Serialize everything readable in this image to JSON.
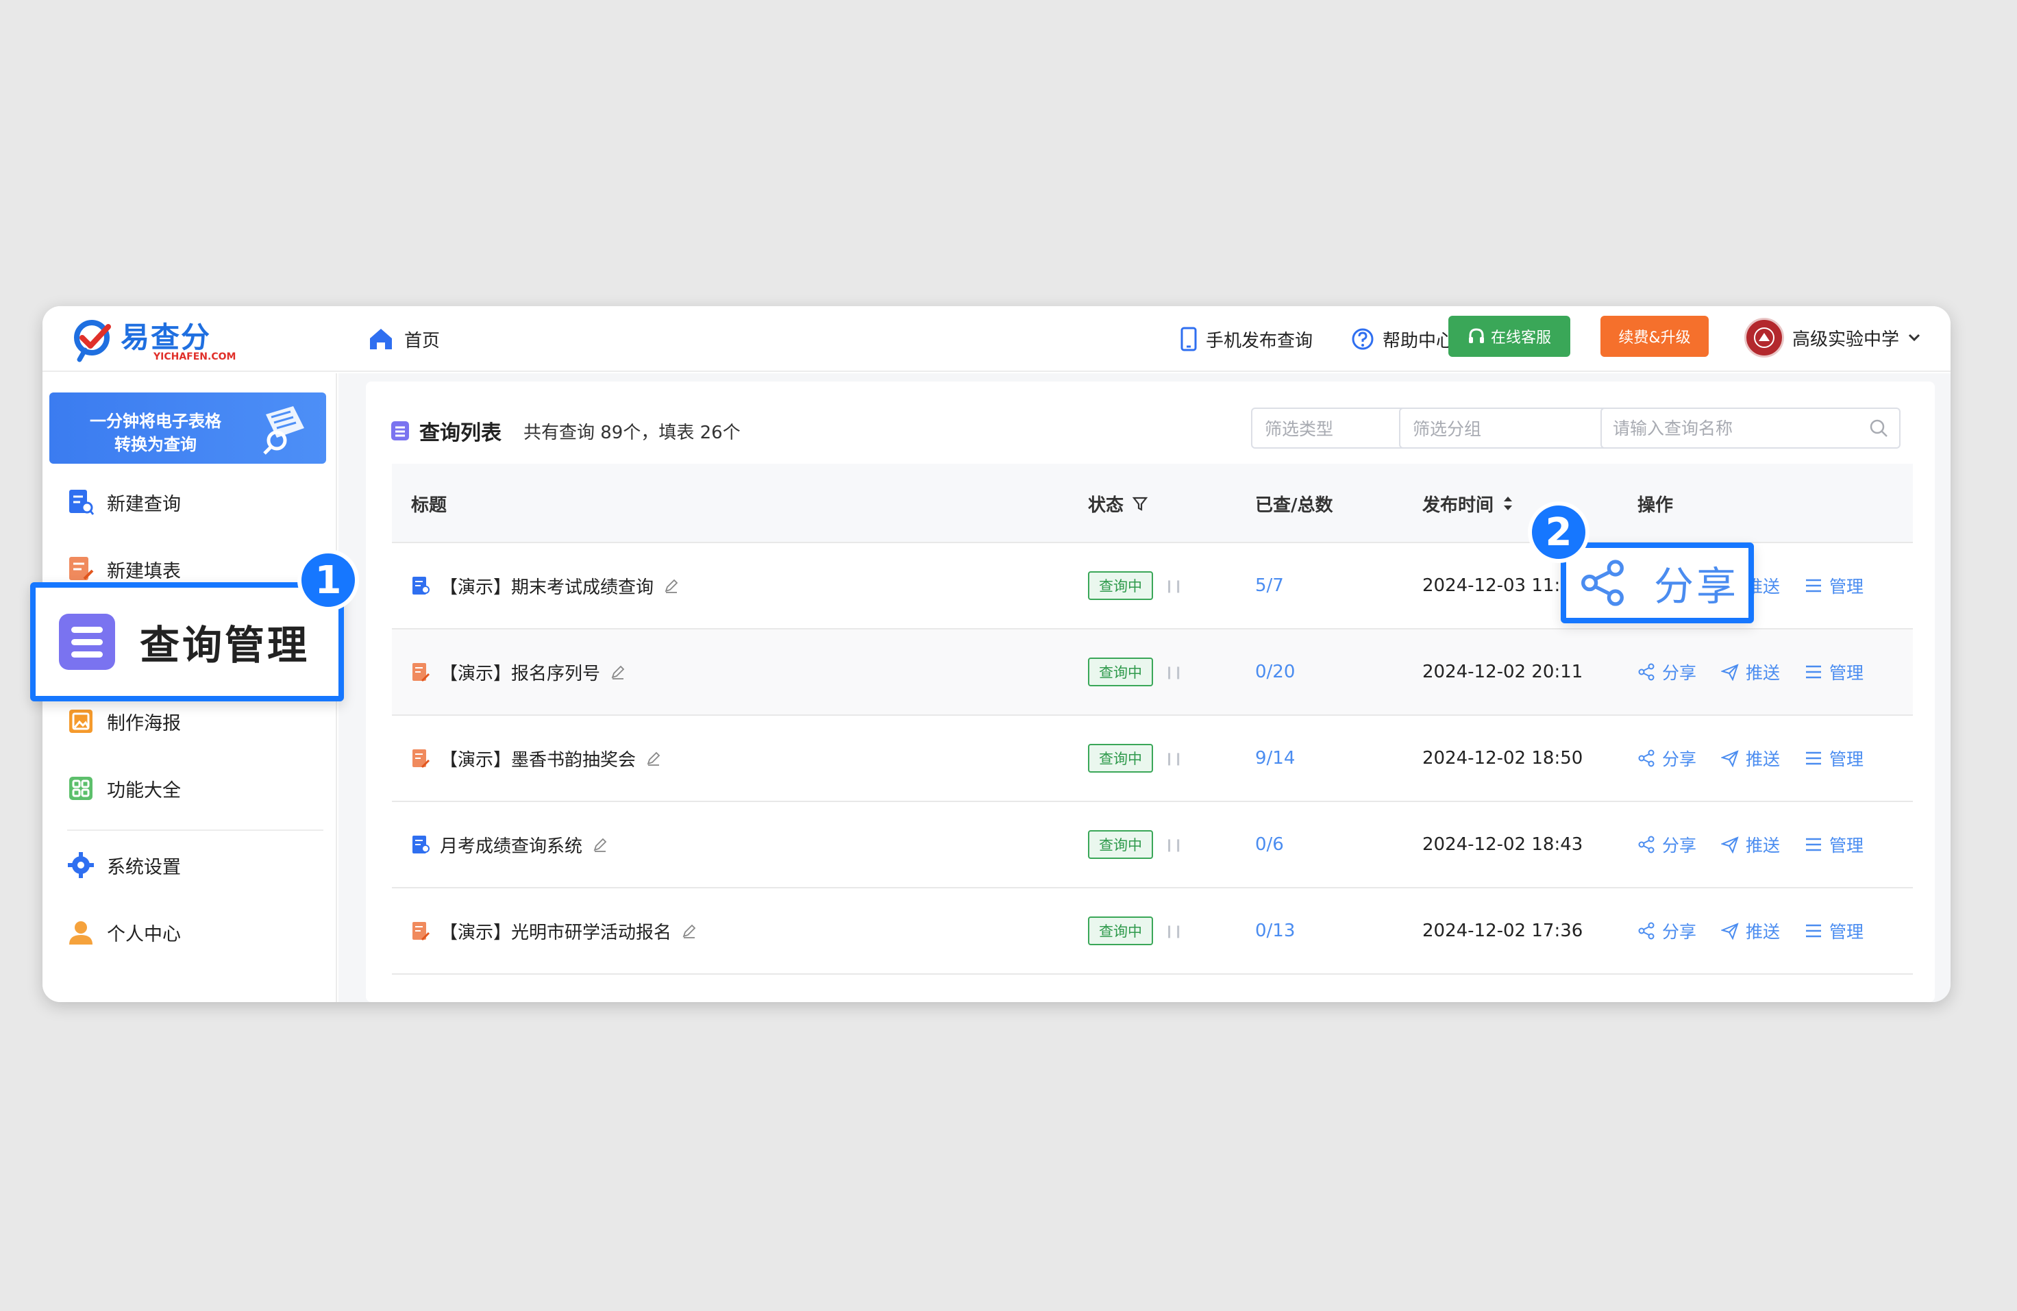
{
  "logo": {
    "brand": "易查分",
    "sub": "YICHAFEN.COM"
  },
  "topbar": {
    "home_label": "首页",
    "mobile_publish": "手机发布查询",
    "help_center": "帮助中心",
    "online_service": "在线客服",
    "renew_upgrade": "续费&升级",
    "school_name": "高级实验中学"
  },
  "sidebar": {
    "banner_line1": "一分钟将电子表格",
    "banner_line2": "转换为查询",
    "items": [
      {
        "label": "新建查询",
        "icon": "new-query-icon"
      },
      {
        "label": "新建填表",
        "icon": "new-form-icon"
      },
      {
        "label": "查询管理",
        "icon": "query-manage-icon"
      },
      {
        "label": "制作海报",
        "icon": "poster-icon"
      },
      {
        "label": "功能大全",
        "icon": "features-icon"
      },
      {
        "label": "系统设置",
        "icon": "settings-icon"
      },
      {
        "label": "个人中心",
        "icon": "user-icon"
      }
    ]
  },
  "list": {
    "title": "查询列表",
    "stats": "共有查询 89个，填表 26个",
    "filter_type_placeholder": "筛选类型",
    "filter_group_placeholder": "筛选分组",
    "search_placeholder": "请输入查询名称"
  },
  "table": {
    "columns": {
      "title": "标题",
      "status": "状态",
      "count": "已查/总数",
      "time": "发布时间",
      "ops": "操作"
    },
    "ops_labels": {
      "share": "分享",
      "push": "推送",
      "manage": "管理"
    },
    "rows": [
      {
        "title": "【演示】期末考试成绩查询",
        "kind": "query",
        "status": "查询中",
        "count": "5/7",
        "time": "2024-12-03 11:5"
      },
      {
        "title": "【演示】报名序列号",
        "kind": "form",
        "status": "查询中",
        "count": "0/20",
        "time": "2024-12-02 20:11"
      },
      {
        "title": "【演示】墨香书韵抽奖会",
        "kind": "form",
        "status": "查询中",
        "count": "9/14",
        "time": "2024-12-02 18:50"
      },
      {
        "title": "月考成绩查询系统",
        "kind": "query",
        "status": "查询中",
        "count": "0/6",
        "time": "2024-12-02 18:43"
      },
      {
        "title": "【演示】光明市研学活动报名",
        "kind": "form",
        "status": "查询中",
        "count": "0/13",
        "time": "2024-12-02 17:36"
      }
    ]
  },
  "callouts": {
    "step1_number": "1",
    "step1_label": "查询管理",
    "step2_number": "2",
    "step2_label": "分享"
  },
  "colors": {
    "accent": "#1677ff",
    "link": "#4a8cf0",
    "green": "#3aa758",
    "orange": "#f5702c",
    "purple": "#7a73f0"
  }
}
